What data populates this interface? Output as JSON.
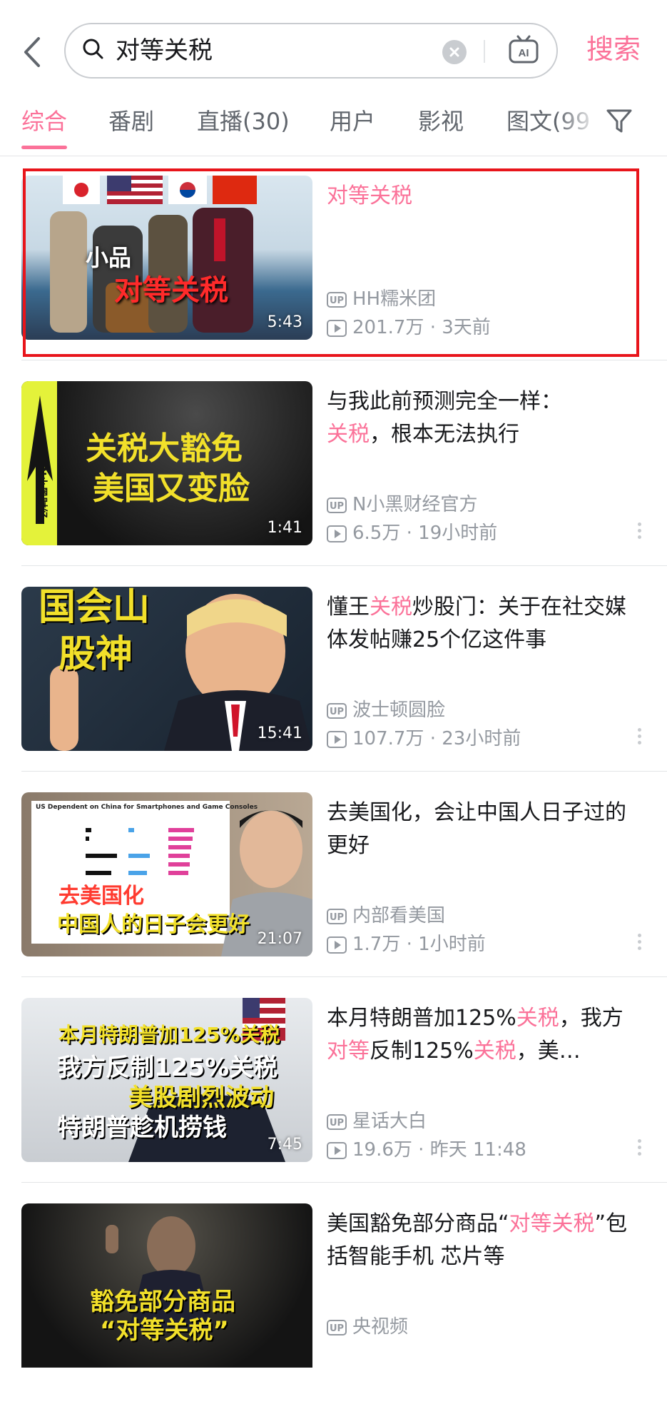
{
  "search": {
    "query": "对等关税",
    "button_label": "搜索"
  },
  "tabs": [
    {
      "label": "综合"
    },
    {
      "label": "番剧"
    },
    {
      "label": "直播(30)"
    },
    {
      "label": "用户"
    },
    {
      "label": "影视"
    },
    {
      "label": "图文(99"
    }
  ],
  "videos": [
    {
      "title_parts": [
        "对等关税"
      ],
      "uploader": "HH糯米团",
      "views": "201.7万",
      "age": "3天前",
      "duration": "5:43",
      "thumb_text": [
        "小品",
        "对等关税"
      ]
    },
    {
      "title_parts": [
        "与我此前预测完全一样：",
        "关税",
        "，根本无法执行"
      ],
      "uploader": "N小黑财经官方",
      "views": "6.5万",
      "age": "19小时前",
      "duration": "1:41",
      "thumb_text": [
        "关税大豁免",
        "美国又变脸",
        "N小黑财经"
      ]
    },
    {
      "title_parts": [
        "懂王",
        "关税",
        "炒股门：关于在社交媒体发帖赚25个亿这件事"
      ],
      "uploader": "波士顿圆脸",
      "views": "107.7万",
      "age": "23小时前",
      "duration": "15:41",
      "thumb_text": [
        "国会山",
        "股神"
      ]
    },
    {
      "title_parts": [
        "去美国化，会让中国人日子过的更好"
      ],
      "uploader": "内部看美国",
      "views": "1.7万",
      "age": "1小时前",
      "duration": "21:07",
      "thumb_text": [
        "去美国化",
        "中国人的日子会更好",
        "US Dependent on China for Smartphones and Game Consoles"
      ]
    },
    {
      "title_parts": [
        "本月特朗普加125%",
        "关税",
        "，我方",
        "对等",
        "反制125%",
        "关税",
        "，美…"
      ],
      "uploader": "星话大白",
      "views": "19.6万",
      "age": "昨天 11:48",
      "duration": "7:45",
      "thumb_text": [
        "本月特朗普加125%关税",
        "我方反制125%关税",
        "美股剧烈波动",
        "特朗普趁机捞钱"
      ]
    },
    {
      "title_parts": [
        "美国豁免部分商品“",
        "对等关税",
        "”包括智能手机 芯片等"
      ],
      "uploader": "央视频",
      "views": "",
      "age": "",
      "duration": "",
      "thumb_text": [
        "豁免部分商品",
        "“对等关税”"
      ]
    }
  ],
  "colors": {
    "accent": "#fb7299",
    "highlight_box": "#e8151b",
    "meta": "#9499a0"
  },
  "up_badge": "UP",
  "ai_icon_label": "AI",
  "stat_separator": "·"
}
